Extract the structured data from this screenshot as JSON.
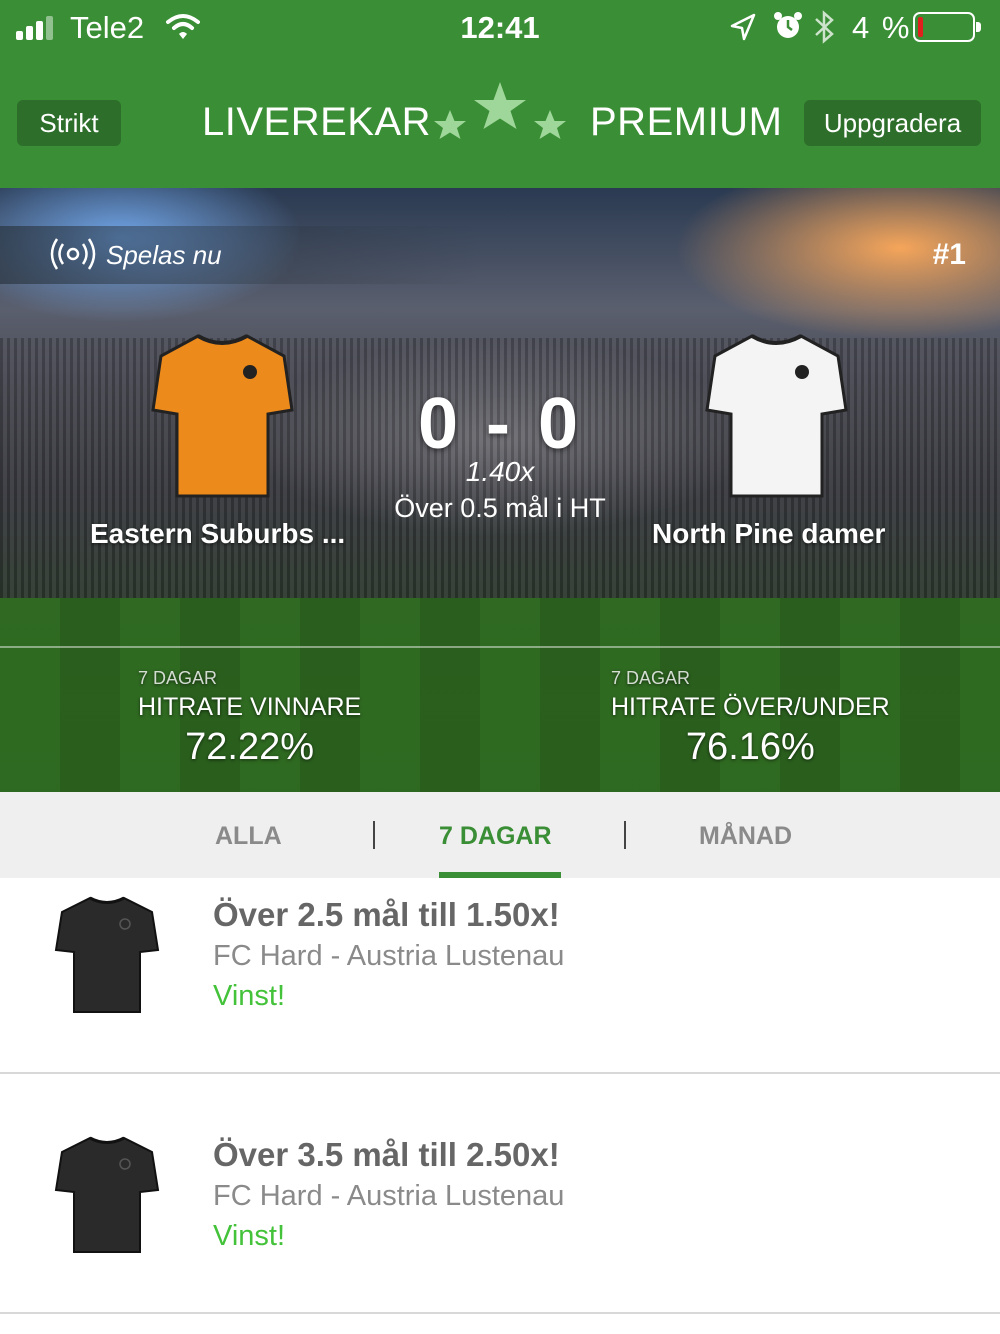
{
  "status_bar": {
    "carrier": "Tele2",
    "time": "12:41",
    "battery": "4 %"
  },
  "header": {
    "left_button": "Strikt",
    "brand_left": "LIVEREKAR",
    "brand_right": "PREMIUM",
    "right_button": "Uppgradera"
  },
  "featured": {
    "live_label": "Spelas nu",
    "rank": "#1",
    "home_team": "Eastern Suburbs ...",
    "away_team": "North Pine damer",
    "score": "0 - 0",
    "odds": "1.40x",
    "tip": "Över 0.5 mål i HT",
    "home_shirt_color": "#ec8a1c",
    "away_shirt_color": "#f4f4f4",
    "stats": [
      {
        "period": "7 DAGAR",
        "label": "HITRATE VINNARE",
        "value": "72.22%"
      },
      {
        "period": "7 DAGAR",
        "label": "HITRATE ÖVER/UNDER",
        "value": "76.16%"
      }
    ]
  },
  "tabs": {
    "items": [
      "ALLA",
      "7 DAGAR",
      "MÅNAD"
    ],
    "active": "7 DAGAR"
  },
  "tips": [
    {
      "title": "Över 2.5 mål till 1.50x!",
      "match": "FC Hard - Austria Lustenau",
      "result": "Vinst!"
    },
    {
      "title": "Över 3.5 mål till 2.50x!",
      "match": "FC Hard - Austria Lustenau",
      "result": "Vinst!"
    }
  ],
  "colors": {
    "brand_green": "#3a8e35",
    "win_green": "#43c23a"
  }
}
